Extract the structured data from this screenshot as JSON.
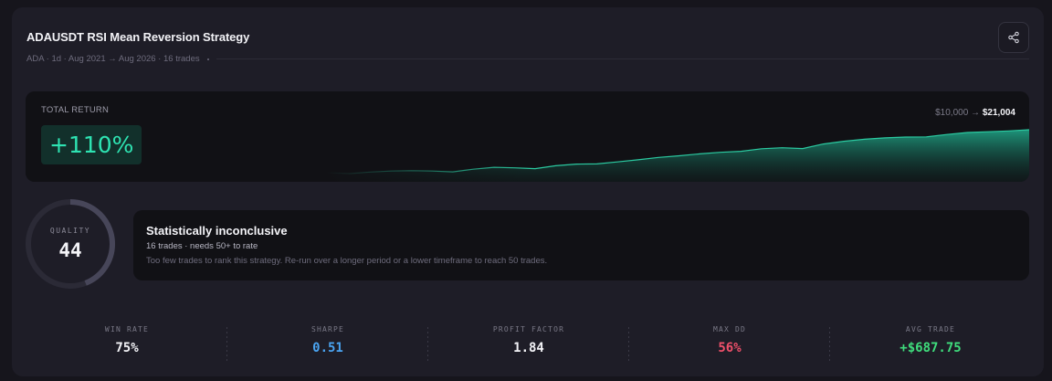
{
  "strategy": {
    "title": "ADAUSDT RSI Mean Reversion Strategy",
    "subtitle": "ADA · 1d · Aug 2021 → Aug 2026 · 16 trades"
  },
  "actions": {
    "share_icon": "share-icon"
  },
  "return": {
    "label": "TOTAL RETURN",
    "value": "+110%",
    "from": "$10,000 →",
    "to": "$21,004",
    "color": "#2ee3b2"
  },
  "equity_curve": [
    10000,
    10100,
    9900,
    10300,
    10550,
    10650,
    10550,
    10350,
    11000,
    11500,
    11350,
    11150,
    11900,
    12300,
    12350,
    12850,
    13400,
    14000,
    14400,
    14900,
    15300,
    15550,
    16200,
    16450,
    16250,
    17400,
    18100,
    18600,
    18950,
    19150,
    19200,
    19800,
    20300,
    20500,
    20700,
    21004
  ],
  "quality": {
    "label": "QUALITY",
    "score": "44",
    "score_value": 44,
    "max": 100
  },
  "notice": {
    "title": "Statistically inconclusive",
    "subtitle": "16 trades · needs 50+ to rate",
    "description": "Too few trades to rank this strategy. Re-run over a longer period or a lower timeframe to reach 50 trades."
  },
  "stats": [
    {
      "label": "WIN RATE",
      "value": "75%",
      "color": "#f2f2f6"
    },
    {
      "label": "SHARPE",
      "value": "0.51",
      "color": "#4aa3f0"
    },
    {
      "label": "PROFIT FACTOR",
      "value": "1.84",
      "color": "#f2f2f6"
    },
    {
      "label": "MAX DD",
      "value": "56%",
      "color": "#f0506a"
    },
    {
      "label": "AVG TRADE",
      "value": "+$687.75",
      "color": "#3fdc7c"
    }
  ]
}
